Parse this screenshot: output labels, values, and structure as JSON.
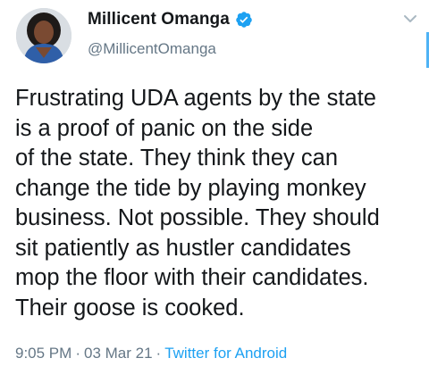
{
  "user": {
    "display_name": "Millicent Omanga",
    "handle": "@MillicentOmanga"
  },
  "tweet": {
    "lines": [
      "Frustrating UDA agents by the state",
      "is a proof of panic on the side",
      "of the state. They think they can",
      "change the tide by playing monkey",
      "business. Not possible. They should",
      "sit patiently as hustler candidates",
      "mop the floor with their candidates.",
      "Their goose is cooked."
    ],
    "time": "9:05 PM",
    "separator": "·",
    "date": "03 Mar 21",
    "source": "Twitter for Android"
  },
  "icons": {
    "verified": "verified-badge-icon",
    "menu": "chevron-down-icon"
  },
  "colors": {
    "verified_blue": "#1da1f2",
    "meta_gray": "#657786",
    "link_blue": "#1da1f2",
    "text": "#14171a"
  }
}
